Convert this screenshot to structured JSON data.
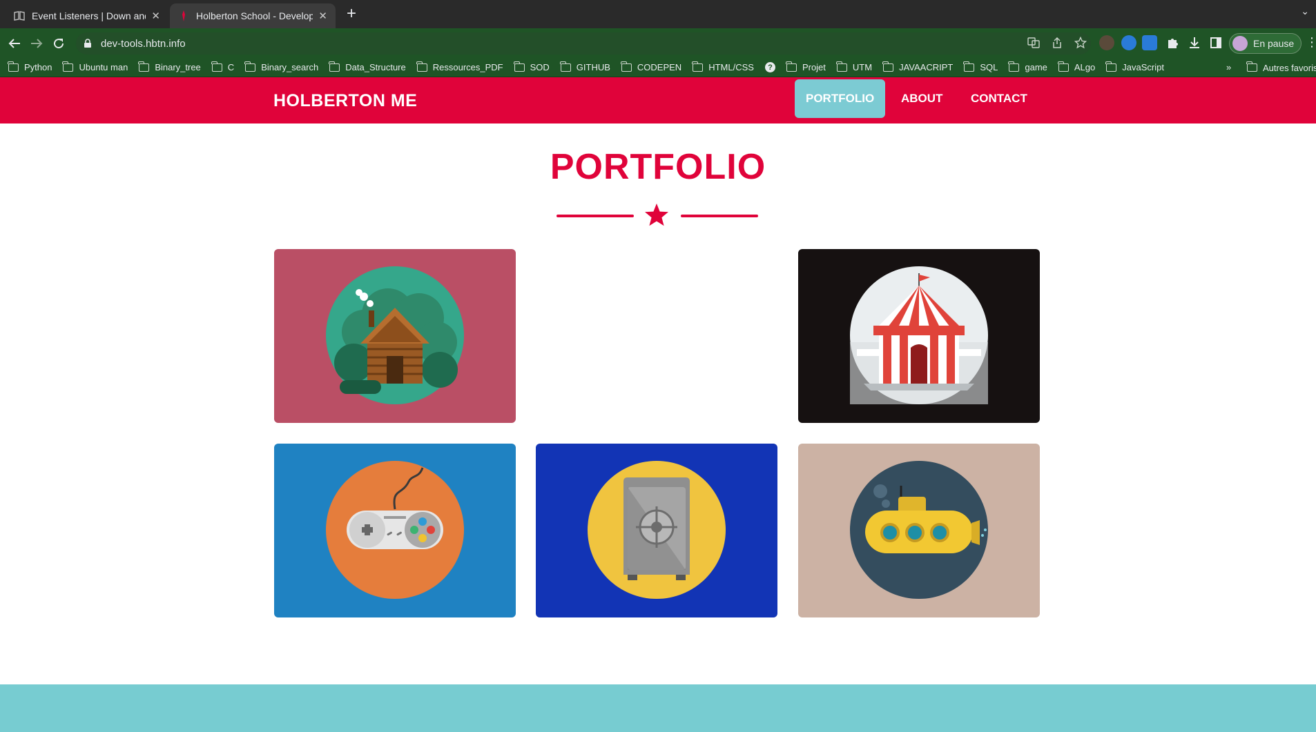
{
  "browser": {
    "tabs": [
      {
        "title": "Event Listeners | Down and Dir",
        "active": false
      },
      {
        "title": "Holberton School - Developer",
        "active": true
      }
    ],
    "url": "dev-tools.hbtn.info",
    "profile_label": "En pause",
    "bookmarks": [
      "Python",
      "Ubuntu man",
      "Binary_tree",
      "C",
      "Binary_search",
      "Data_Structure",
      "Ressources_PDF",
      "SOD",
      "GITHUB",
      "CODEPEN",
      "HTML/CSS",
      "Projet",
      "UTM",
      "JAVAACRIPT",
      "SQL",
      "game",
      "ALgo",
      "JavaScript"
    ],
    "bookmarks_overflow": "»",
    "other_bookmarks": "Autres favoris"
  },
  "site": {
    "brand": "HOLBERTON ME",
    "nav": [
      {
        "label": "PORTFOLIO",
        "active": true
      },
      {
        "label": "ABOUT",
        "active": false
      },
      {
        "label": "CONTACT",
        "active": false
      }
    ],
    "section_title": "PORTFOLIO",
    "colors": {
      "primary": "#e0033a",
      "accent": "#7ccbd3",
      "footer": "#77ccd1"
    },
    "portfolio": [
      {
        "icon": "cabin-icon",
        "bg": "#ba4f65"
      },
      {
        "icon": "empty-slot",
        "bg": "#ffffff"
      },
      {
        "icon": "circus-tent-icon",
        "bg": "#161111"
      },
      {
        "icon": "game-controller-icon",
        "bg": "#1f82c2"
      },
      {
        "icon": "safe-icon",
        "bg": "#1234b5"
      },
      {
        "icon": "submarine-icon",
        "bg": "#ccb2a4"
      }
    ]
  }
}
